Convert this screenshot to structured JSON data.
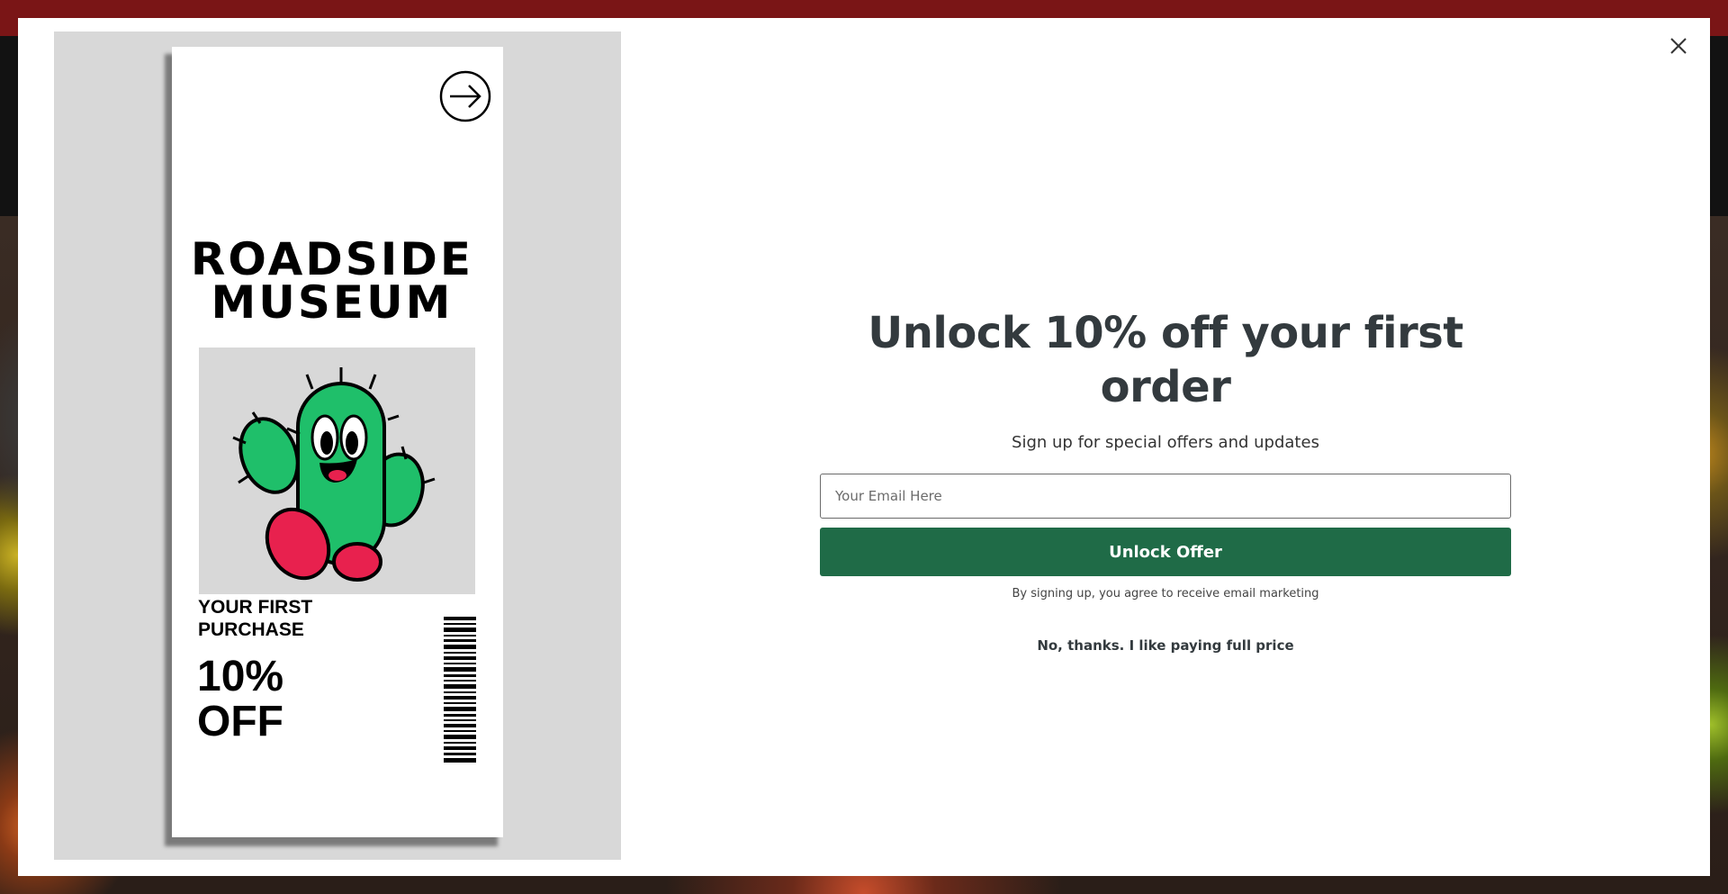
{
  "modal": {
    "close_icon": "close-icon",
    "image": {
      "title": "ROADSIDE MUSEUM",
      "purchase_label": "YOUR FIRST PURCHASE",
      "discount": "10% OFF",
      "arrow_icon": "arrow-right-circle-icon"
    },
    "headline": "Unlock 10% off your first order",
    "subheadline": "Sign up for special offers and updates",
    "email_placeholder": "Your Email Here",
    "submit_label": "Unlock Offer",
    "disclaimer": "By signing up, you agree to receive email marketing",
    "decline_label": "No, thanks. I like paying full price"
  },
  "colors": {
    "accent_button": "#1f6b47",
    "announcement_bar": "#7a1516",
    "header": "#121212",
    "cactus": "#1fbf6a",
    "shoes": "#e8214e"
  }
}
